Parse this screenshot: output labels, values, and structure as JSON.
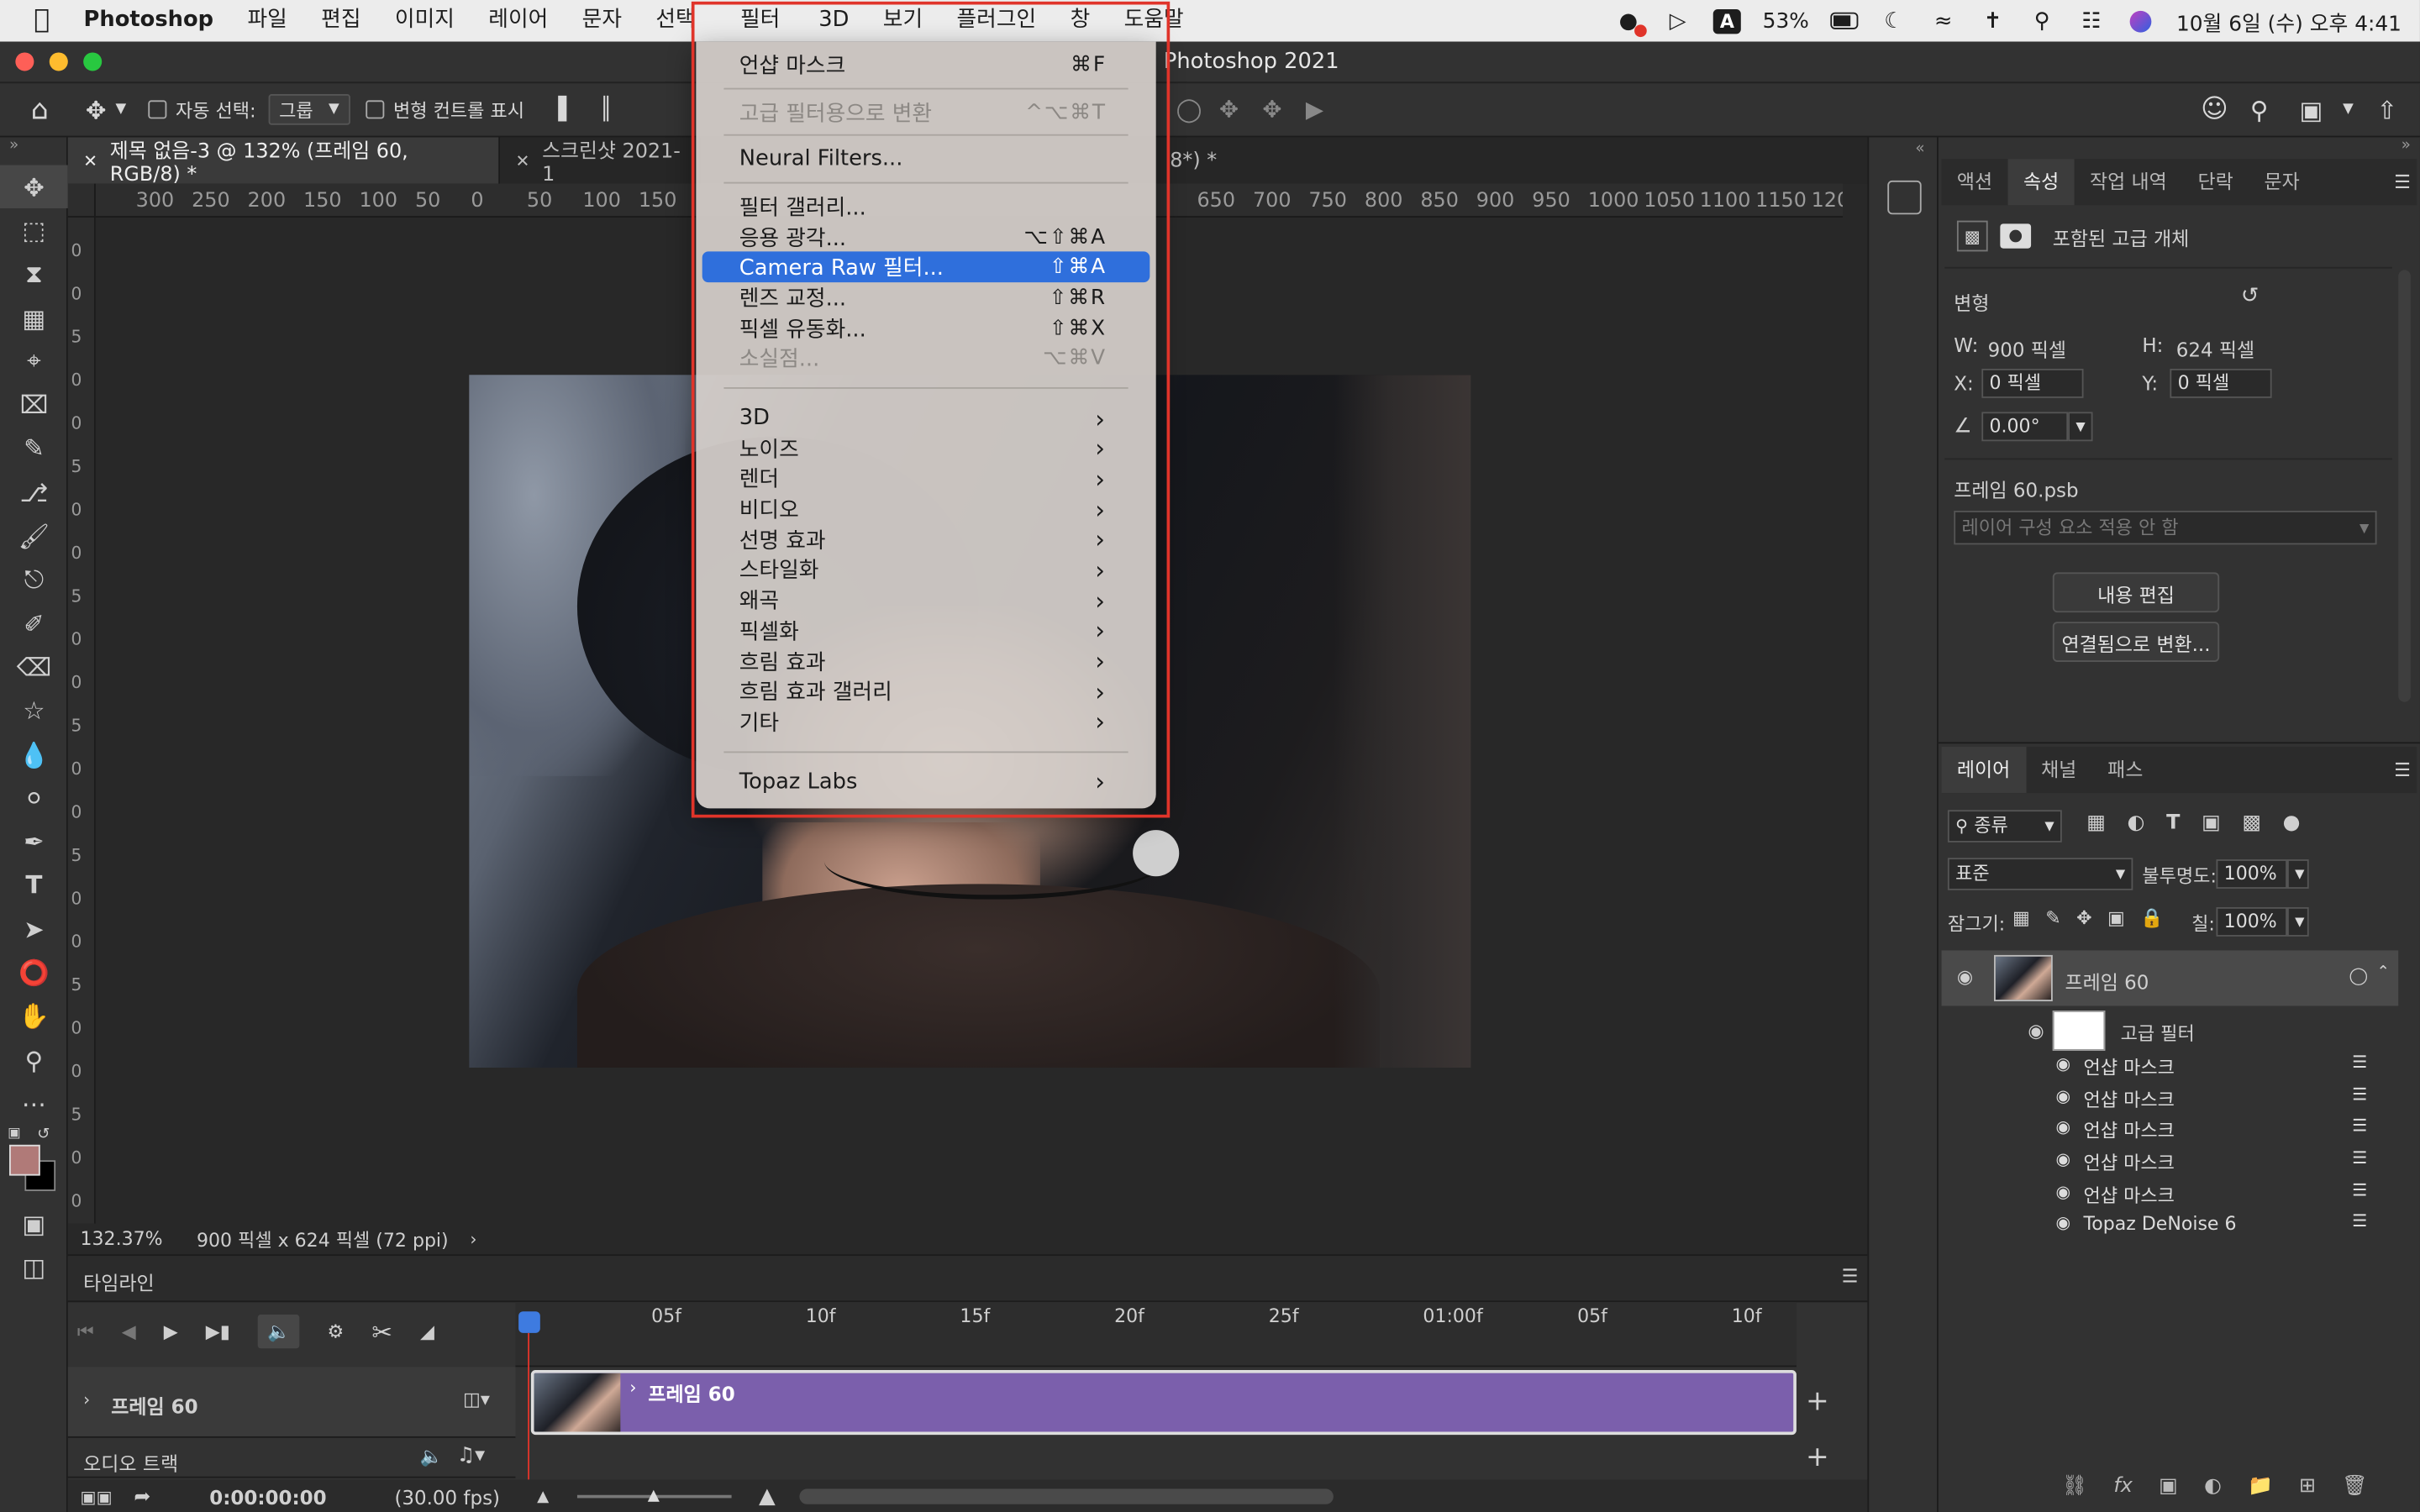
{
  "menubar": {
    "app": "Photoshop",
    "items": [
      "파일",
      "편집",
      "이미지",
      "레이어",
      "문자",
      "선택",
      "필터",
      "3D",
      "보기",
      "플러그인",
      "창",
      "도움말"
    ],
    "active": "필터",
    "status": {
      "battery": "53%",
      "datetime": "10월 6일 (수) 오후 4:41",
      "input_method": "A"
    }
  },
  "window": {
    "title": "Photoshop 2021"
  },
  "options_bar": {
    "auto_select_label": "자동 선택:",
    "auto_select_value": "그룹",
    "transform_controls_label": "변형 컨트롤 표시"
  },
  "tabs": [
    {
      "label": "제목 없음-3 @ 132% (프레임 60, RGB/8) *",
      "active": true
    },
    {
      "label": "스크린샷 2021-1",
      "active": false
    },
    {
      "label": "8*) *",
      "active": false
    }
  ],
  "rulers": {
    "h_ticks": [
      "300",
      "250",
      "200",
      "150",
      "100",
      "50",
      "0",
      "50",
      "100",
      "150",
      "",
      "",
      "",
      "",
      "",
      "",
      "",
      "",
      "",
      "650",
      "700",
      "750",
      "800",
      "850",
      "900",
      "950",
      "1000",
      "1050",
      "1100",
      "1150",
      "120"
    ],
    "v_ticks": [
      "0",
      "0",
      "5",
      "0",
      "0",
      "5",
      "0",
      "0",
      "5",
      "0",
      "0",
      "5",
      "0",
      "0",
      "5",
      "0",
      "0",
      "5",
      "0",
      "0",
      "5",
      "0",
      "0"
    ]
  },
  "status_bar": {
    "zoom": "132.37%",
    "doc_info": "900 픽셀 x 624 픽셀 (72 ppi)"
  },
  "filter_menu": {
    "groups": [
      [
        {
          "label": "언샵 마스크",
          "shortcut": "⌘F",
          "disabled": false
        }
      ],
      [
        {
          "label": "고급 필터용으로 변환",
          "shortcut": "^⌥⌘T",
          "disabled": true
        }
      ],
      [
        {
          "label": "Neural Filters...",
          "shortcut": "",
          "disabled": false
        }
      ],
      [
        {
          "label": "필터 갤러리...",
          "shortcut": "",
          "disabled": false
        },
        {
          "label": "응용 광각...",
          "shortcut": "⌥⇧⌘A",
          "disabled": false
        },
        {
          "label": "Camera Raw 필터...",
          "shortcut": "⇧⌘A",
          "disabled": false,
          "highlighted": true
        },
        {
          "label": "렌즈 교정...",
          "shortcut": "⇧⌘R",
          "disabled": false
        },
        {
          "label": "픽셀 유동화...",
          "shortcut": "⇧⌘X",
          "disabled": false
        },
        {
          "label": "소실점...",
          "shortcut": "⌥⌘V",
          "disabled": true
        }
      ],
      [
        {
          "label": "3D",
          "submenu": true
        },
        {
          "label": "노이즈",
          "submenu": true
        },
        {
          "label": "렌더",
          "submenu": true
        },
        {
          "label": "비디오",
          "submenu": true
        },
        {
          "label": "선명 효과",
          "submenu": true
        },
        {
          "label": "스타일화",
          "submenu": true
        },
        {
          "label": "왜곡",
          "submenu": true
        },
        {
          "label": "픽셀화",
          "submenu": true
        },
        {
          "label": "흐림 효과",
          "submenu": true
        },
        {
          "label": "흐림 효과 갤러리",
          "submenu": true
        },
        {
          "label": "기타",
          "submenu": true
        }
      ],
      [
        {
          "label": "Topaz Labs",
          "submenu": true
        }
      ]
    ]
  },
  "properties_panel": {
    "tabs": [
      "액션",
      "속성",
      "작업 내역",
      "단락",
      "문자"
    ],
    "active_tab": "속성",
    "object_type": "포함된 고급 개체",
    "transform_label": "변형",
    "w_label": "W:",
    "w_value": "900 픽셀",
    "h_label": "H:",
    "h_value": "624 픽셀",
    "x_label": "X:",
    "x_value": "0 픽셀",
    "y_label": "Y:",
    "y_value": "0 픽셀",
    "angle": "0.00°",
    "file_name": "프레임 60.psb",
    "comp_placeholder": "레이어 구성 요소 적용 안 함",
    "edit_contents": "내용 편집",
    "convert_linked": "연결됨으로 변환..."
  },
  "layers_panel": {
    "tabs": [
      "레이어",
      "채널",
      "패스"
    ],
    "active_tab": "레이어",
    "filter_kind": "종류",
    "blend_mode": "표준",
    "opacity_label": "불투명도:",
    "opacity": "100%",
    "lock_label": "잠그기:",
    "fill_label": "칠:",
    "fill": "100%",
    "layer_name": "프레임 60",
    "smart_filters_label": "고급 필터",
    "filters": [
      "언샵 마스크",
      "언샵 마스크",
      "언샵 마스크",
      "언샵 마스크",
      "언샵 마스크",
      "Topaz DeNoise 6"
    ]
  },
  "timeline": {
    "title": "타임라인",
    "ruler": [
      "05f",
      "10f",
      "15f",
      "20f",
      "25f",
      "01:00f",
      "05f",
      "10f"
    ],
    "track_name": "프레임 60",
    "clip_label": "프레임 60",
    "audio_track": "오디오 트랙",
    "timecode": "0:00:00:00",
    "fps": "(30.00 fps)",
    "clip_color": "#7b5fac"
  },
  "colors": {
    "accent_highlight": "#2f6fdc",
    "annotation": "#e0342a",
    "foreground_swatch": "#b07a78"
  }
}
